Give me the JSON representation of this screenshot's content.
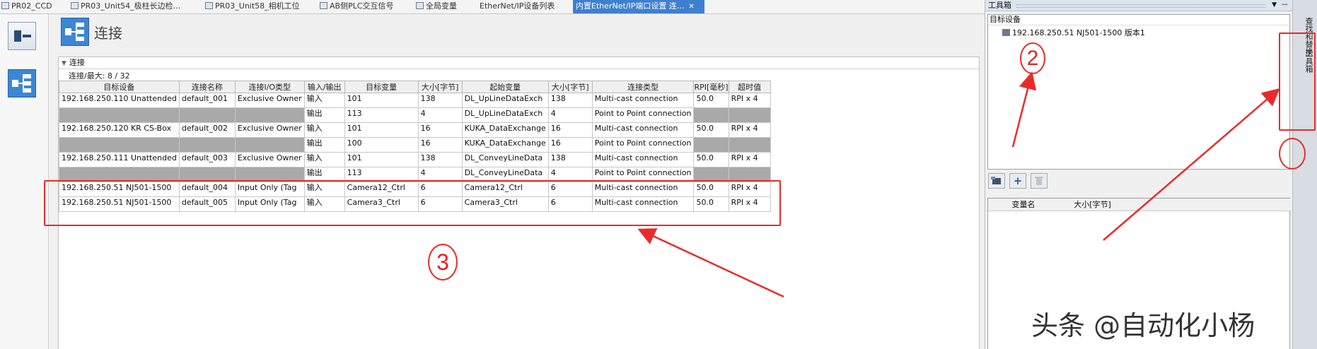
{
  "tabs": [
    {
      "label": "PR02_CCD",
      "active": false
    },
    {
      "label": "PR03_Unit54_极柱长边检...",
      "active": false
    },
    {
      "label": "PR03_Unit58_相机工位",
      "active": false
    },
    {
      "label": "AB侧PLC交互信号",
      "active": false
    },
    {
      "label": "全局变量",
      "active": false
    },
    {
      "label": "EtherNet/IP设备列表",
      "active": false
    },
    {
      "label": "内置EtherNet/IP端口设置 连...",
      "active": true
    }
  ],
  "page": {
    "title": "连接"
  },
  "connections": {
    "section_label": "连接",
    "max_label": "连接/最大: 8 / 32",
    "columns": [
      "目标设备",
      "连接名称",
      "连接I/O类型",
      "输入/输出",
      "目标变量",
      "大小[字节]",
      "起始变量",
      "大小[字节]",
      "连接类型",
      "RPI[毫秒]",
      "超时值"
    ],
    "rows": [
      [
        "192.168.250.110 Unattended",
        "default_001",
        "Exclusive Owner",
        "输入",
        "101",
        "138",
        "DL_UpLineDataExch",
        "138",
        "Multi-cast connection",
        "50.0",
        "RPI x 4"
      ],
      [
        "",
        "",
        "",
        "输出",
        "113",
        "4",
        "DL_UpLineDataExch",
        "4",
        "Point to Point connection",
        "",
        ""
      ],
      [
        "192.168.250.120 KR CS-Box",
        "default_002",
        "Exclusive Owner",
        "输入",
        "101",
        "16",
        "KUKA_DataExchange",
        "16",
        "Multi-cast connection",
        "50.0",
        "RPI x 4"
      ],
      [
        "",
        "",
        "",
        "输出",
        "100",
        "16",
        "KUKA_DataExchange",
        "16",
        "Point to Point connection",
        "",
        ""
      ],
      [
        "192.168.250.111 Unattended",
        "default_003",
        "Exclusive Owner",
        "输入",
        "101",
        "138",
        "DL_ConveyLineData",
        "138",
        "Multi-cast connection",
        "50.0",
        "RPI x 4"
      ],
      [
        "",
        "",
        "",
        "输出",
        "113",
        "4",
        "DL_ConveyLineData",
        "4",
        "Point to Point connection",
        "",
        ""
      ],
      [
        "192.168.250.51 NJ501-1500",
        "default_004",
        "Input Only (Tag",
        "输入",
        "Camera12_Ctrl",
        "6",
        "Camera12_Ctrl",
        "6",
        "Multi-cast connection",
        "50.0",
        "RPI x 4"
      ],
      [
        "192.168.250.51 NJ501-1500",
        "default_005",
        "Input Only (Tag",
        "输入",
        "Camera3_Ctrl",
        "6",
        "Camera3_Ctrl",
        "6",
        "Multi-cast connection",
        "50.0",
        "RPI x 4"
      ]
    ]
  },
  "toolbox": {
    "title": "工具箱",
    "tree_header": "目标设备",
    "device_node": "192.168.250.51   NJ501-1500   版本1",
    "buttons": [
      {
        "name": "device-group-button",
        "icon": "device-icon"
      },
      {
        "name": "add-button",
        "icon": "plus-icon",
        "glyph": "+"
      },
      {
        "name": "delete-button",
        "icon": "trash-icon"
      }
    ],
    "var_columns": [
      "变量名",
      "大小[字节]"
    ]
  },
  "side_tabs": [
    "查找和替换",
    "工具箱"
  ],
  "annotations": {
    "label_2": "2",
    "label_3": "3"
  },
  "watermark": "头条 @自动化小杨"
}
